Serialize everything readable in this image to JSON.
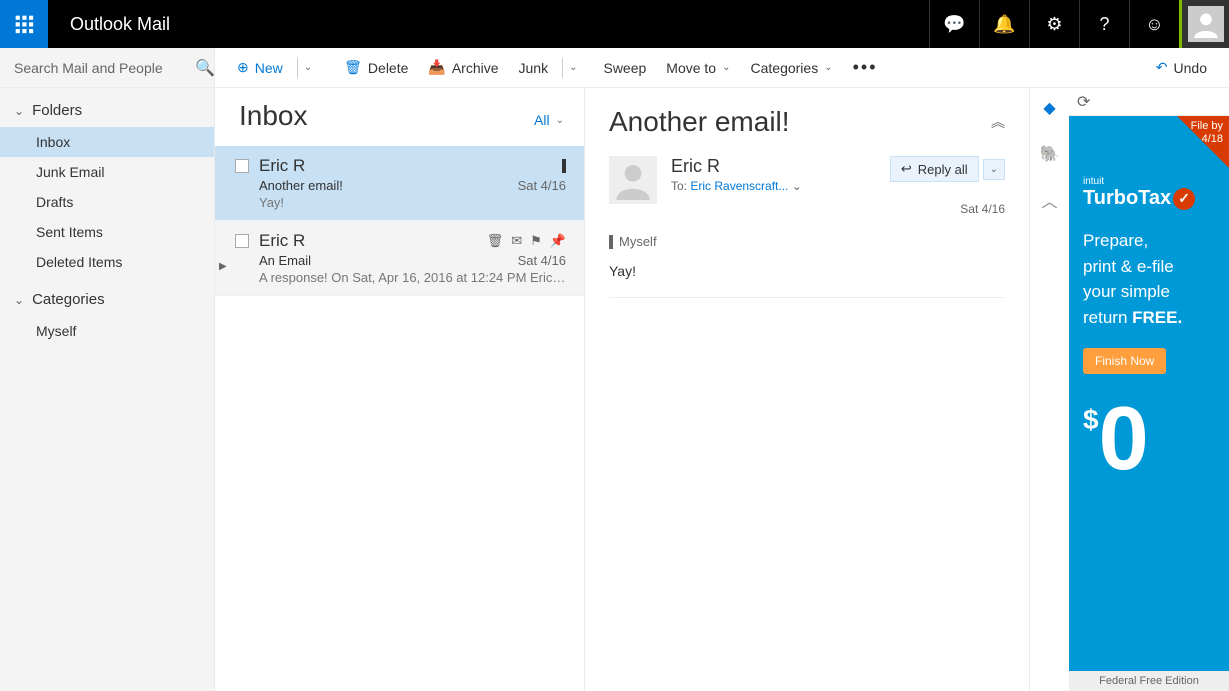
{
  "header": {
    "app_title": "Outlook Mail"
  },
  "search": {
    "placeholder": "Search Mail and People"
  },
  "nav": {
    "folders_label": "Folders",
    "folders": [
      "Inbox",
      "Junk Email",
      "Drafts",
      "Sent Items",
      "Deleted Items"
    ],
    "categories_label": "Categories",
    "categories": [
      "Myself"
    ]
  },
  "commands": {
    "new": "New",
    "delete": "Delete",
    "archive": "Archive",
    "junk": "Junk",
    "sweep": "Sweep",
    "move": "Move to",
    "categories": "Categories",
    "undo": "Undo"
  },
  "list": {
    "title": "Inbox",
    "filter": "All",
    "messages": [
      {
        "from": "Eric R",
        "subject": "Another email!",
        "date": "Sat 4/16",
        "preview": "Yay!",
        "selected": true
      },
      {
        "from": "Eric R",
        "subject": "An Email",
        "date": "Sat 4/16",
        "preview": "A response!   On Sat, Apr 16, 2016 at 12:24 PM Eric Ravens..",
        "selected": false,
        "has_caret": true,
        "hovered": true
      }
    ]
  },
  "reading": {
    "subject": "Another email!",
    "from": "Eric R",
    "to_label": "To:",
    "to": "Eric Ravenscraft...",
    "reply_label": "Reply all",
    "date": "Sat 4/16",
    "category": "Myself",
    "body": "Yay!"
  },
  "ad": {
    "corner1": "File by",
    "corner2": "4/18",
    "brand_small": "intuit",
    "brand": "TurboTax",
    "text1": "Prepare,",
    "text2": "print & e-file",
    "text3": "your simple",
    "text4": "return ",
    "text4b": "FREE.",
    "cta": "Finish Now",
    "zero": "0",
    "footer": "Federal Free Edition"
  }
}
